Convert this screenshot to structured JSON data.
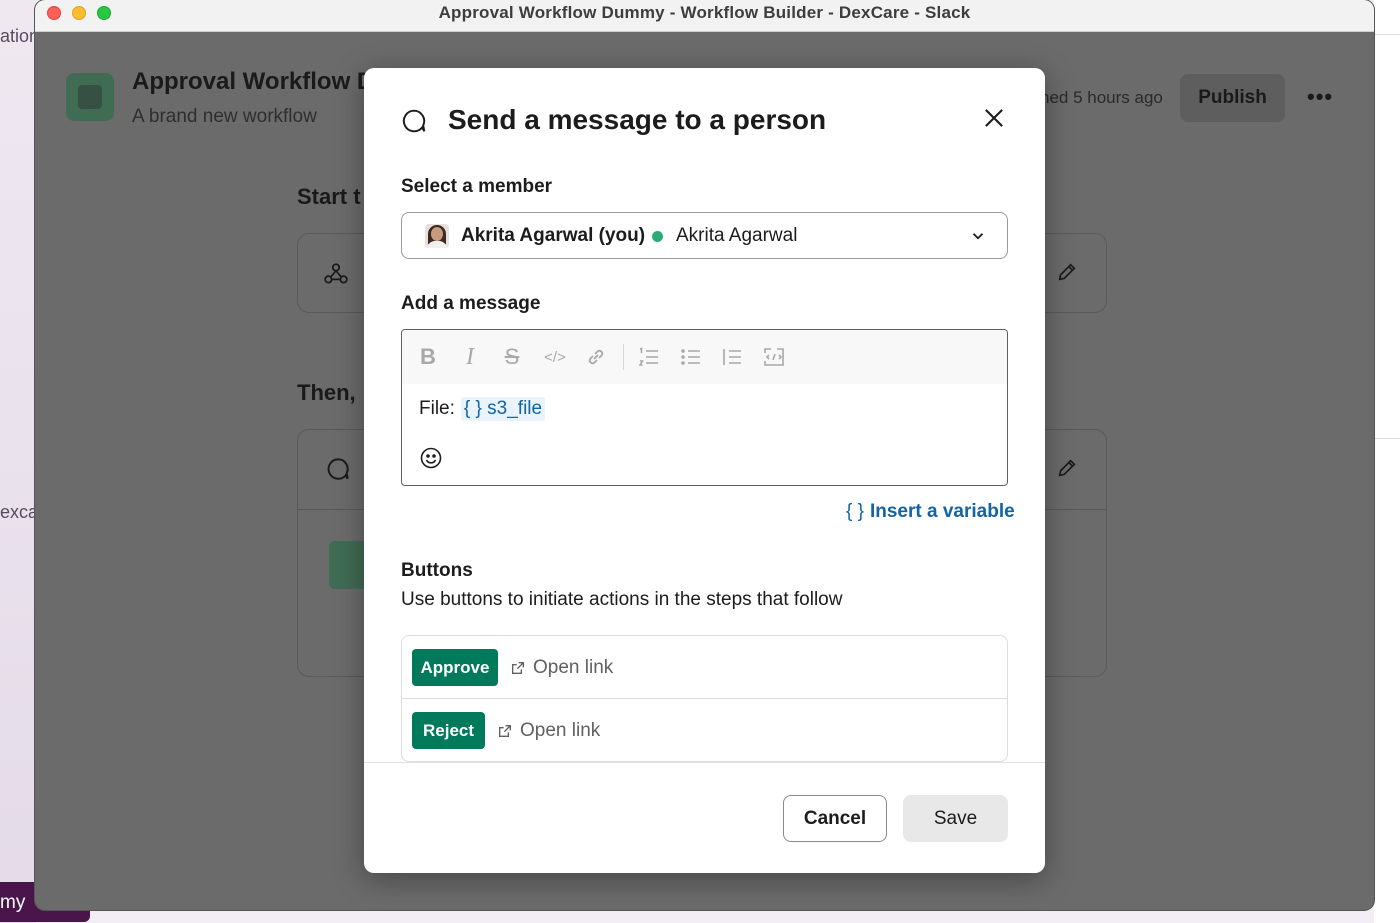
{
  "window": {
    "title": "Approval Workflow Dummy - Workflow Builder - DexCare - Slack"
  },
  "background": {
    "left_text_top": "ation",
    "left_text_mid": "excar",
    "left_text_bottom": "my",
    "workflow_title": "Approval Workflow D",
    "workflow_subtitle": "A brand new workflow",
    "published_text": "hed 5 hours ago",
    "publish_button": "Publish",
    "more_button": "•••",
    "start_label": "Start t",
    "then_label": "Then, "
  },
  "modal": {
    "title": "Send a message to a person",
    "member_label": "Select a member",
    "member": {
      "name": "Akrita Agarwal (you)",
      "display_name": "Akrita Agarwal",
      "presence_color": "#2bac76"
    },
    "message_label": "Add a message",
    "toolbar": [
      "B",
      "I",
      "S",
      "</>",
      "link",
      "1≡",
      "•≡",
      "|≡",
      "{/}"
    ],
    "message": {
      "prefix": "File:",
      "variable": "{ } s3_file"
    },
    "insert_variable": {
      "brace": "{ }",
      "label": "Insert a variable"
    },
    "buttons_label": "Buttons",
    "buttons_description": "Use buttons to initiate actions in the steps that follow",
    "button_rows": [
      {
        "label": "Approve",
        "link_text": "Open link"
      },
      {
        "label": "Reject",
        "link_text": "Open link"
      }
    ],
    "cancel_label": "Cancel",
    "save_label": "Save"
  },
  "colors": {
    "accent_green": "#007a5a",
    "link_blue": "#1264a3",
    "overlay_gray": "#6b6b6b"
  }
}
